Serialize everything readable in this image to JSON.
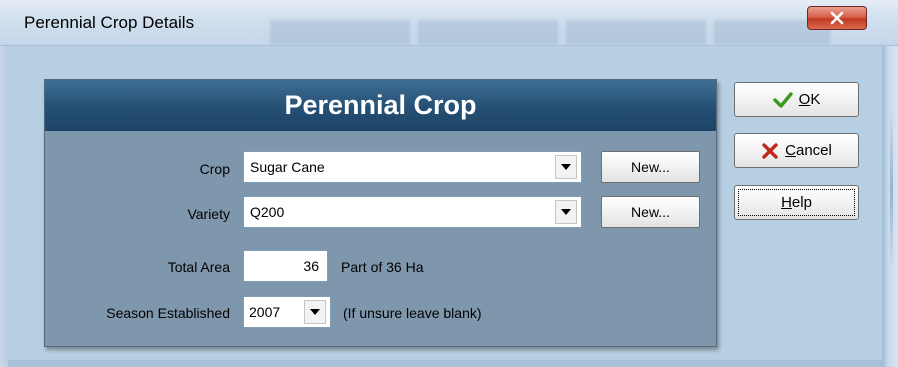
{
  "window": {
    "title": "Perennial Crop Details"
  },
  "panel": {
    "heading": "Perennial Crop"
  },
  "form": {
    "crop": {
      "label": "Crop",
      "value": "Sugar Cane",
      "new_label": "New..."
    },
    "variety": {
      "label": "Variety",
      "value": "Q200",
      "new_label": "New..."
    },
    "total_area": {
      "label": "Total Area",
      "value": "36",
      "note": "Part of 36 Ha"
    },
    "season": {
      "label": "Season Established",
      "value": "2007",
      "note": "(If unsure leave blank)"
    }
  },
  "actions": {
    "ok": {
      "accel": "O",
      "rest": "K"
    },
    "cancel": {
      "accel": "C",
      "rest": "ancel"
    },
    "help": {
      "accel": "H",
      "rest": "elp"
    }
  },
  "colors": {
    "panel_header": "#244f73",
    "panel_body": "#7f97ac",
    "ok_check": "#3a9a1e",
    "cancel_x": "#c0281b",
    "close_button": "#c23a24"
  },
  "icons": {
    "close": "close-icon",
    "ok": "checkmark-icon",
    "cancel": "x-icon",
    "dropdown": "chevron-down-icon"
  }
}
